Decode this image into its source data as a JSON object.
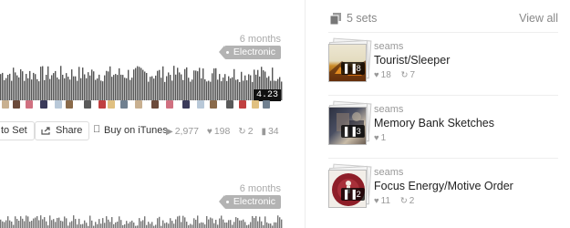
{
  "tracks": [
    {
      "age": "6 months",
      "genre": "Electronic",
      "time": "4.23",
      "actions": {
        "add_to_set": "to Set",
        "share": "Share",
        "buy": "Buy on iTunes",
        "plays": "2,977",
        "likes": "198",
        "reposts": "2",
        "comments": "34"
      }
    },
    {
      "age": "6 months",
      "genre": "Electronic"
    }
  ],
  "sets_panel": {
    "title": "5 sets",
    "view_all": "View all",
    "items": [
      {
        "artist": "seams",
        "title": "Tourist/Sleeper",
        "count": "8",
        "likes": "18",
        "reposts": "7"
      },
      {
        "artist": "seams",
        "title": "Memory Bank Sketches",
        "count": "3",
        "likes": "1"
      },
      {
        "artist": "seams",
        "title": "Focus Energy/Motive Order",
        "count": "2",
        "likes": "11",
        "reposts": "2"
      }
    ]
  },
  "icons": {
    "heart": "heart-icon",
    "repost": "repost-icon",
    "comment": "comment-icon",
    "play": "play-icon",
    "apple": "apple-icon",
    "share": "share-icon",
    "sets": "sets-icon"
  },
  "colors": {
    "genre_tag": "#b3b3b3",
    "waveform": "#555555",
    "time_badge": "#111111"
  }
}
